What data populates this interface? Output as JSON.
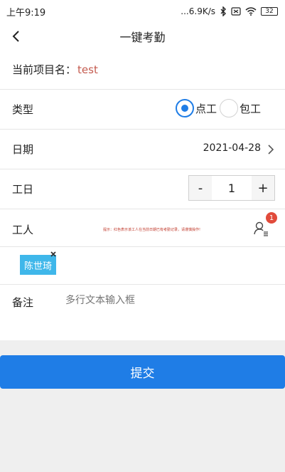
{
  "status_bar": {
    "time": "上午9:19",
    "network_speed": "...6.9K/s",
    "battery": "32",
    "icons": [
      "bluetooth-icon",
      "sim-icon",
      "wifi-icon",
      "battery-icon"
    ]
  },
  "nav": {
    "title": "一键考勤",
    "back_icon": "back-arrow-icon"
  },
  "project": {
    "label": "当前项目名：",
    "value": "test"
  },
  "type_row": {
    "label": "类型",
    "options": [
      {
        "label": "点工",
        "checked": true
      },
      {
        "label": "包工",
        "checked": false
      }
    ]
  },
  "date_row": {
    "label": "日期",
    "value": "2021-04-28"
  },
  "workday_row": {
    "label": "工日",
    "minus": "-",
    "value": "1",
    "plus": "+"
  },
  "worker_row": {
    "label": "工人",
    "hint": "提示：红色表示该工人在当前日期已有考勤记录，请谨慎操作!",
    "badge": "1",
    "selected_workers": [
      "陈世琦"
    ]
  },
  "note": {
    "label": "备注",
    "placeholder": "多行文本输入框"
  },
  "submit": {
    "label": "提交"
  },
  "colors": {
    "accent": "#1f7de6",
    "chip": "#3fb7ea",
    "badge": "#e14b3b",
    "project_value": "#c45b4f"
  }
}
